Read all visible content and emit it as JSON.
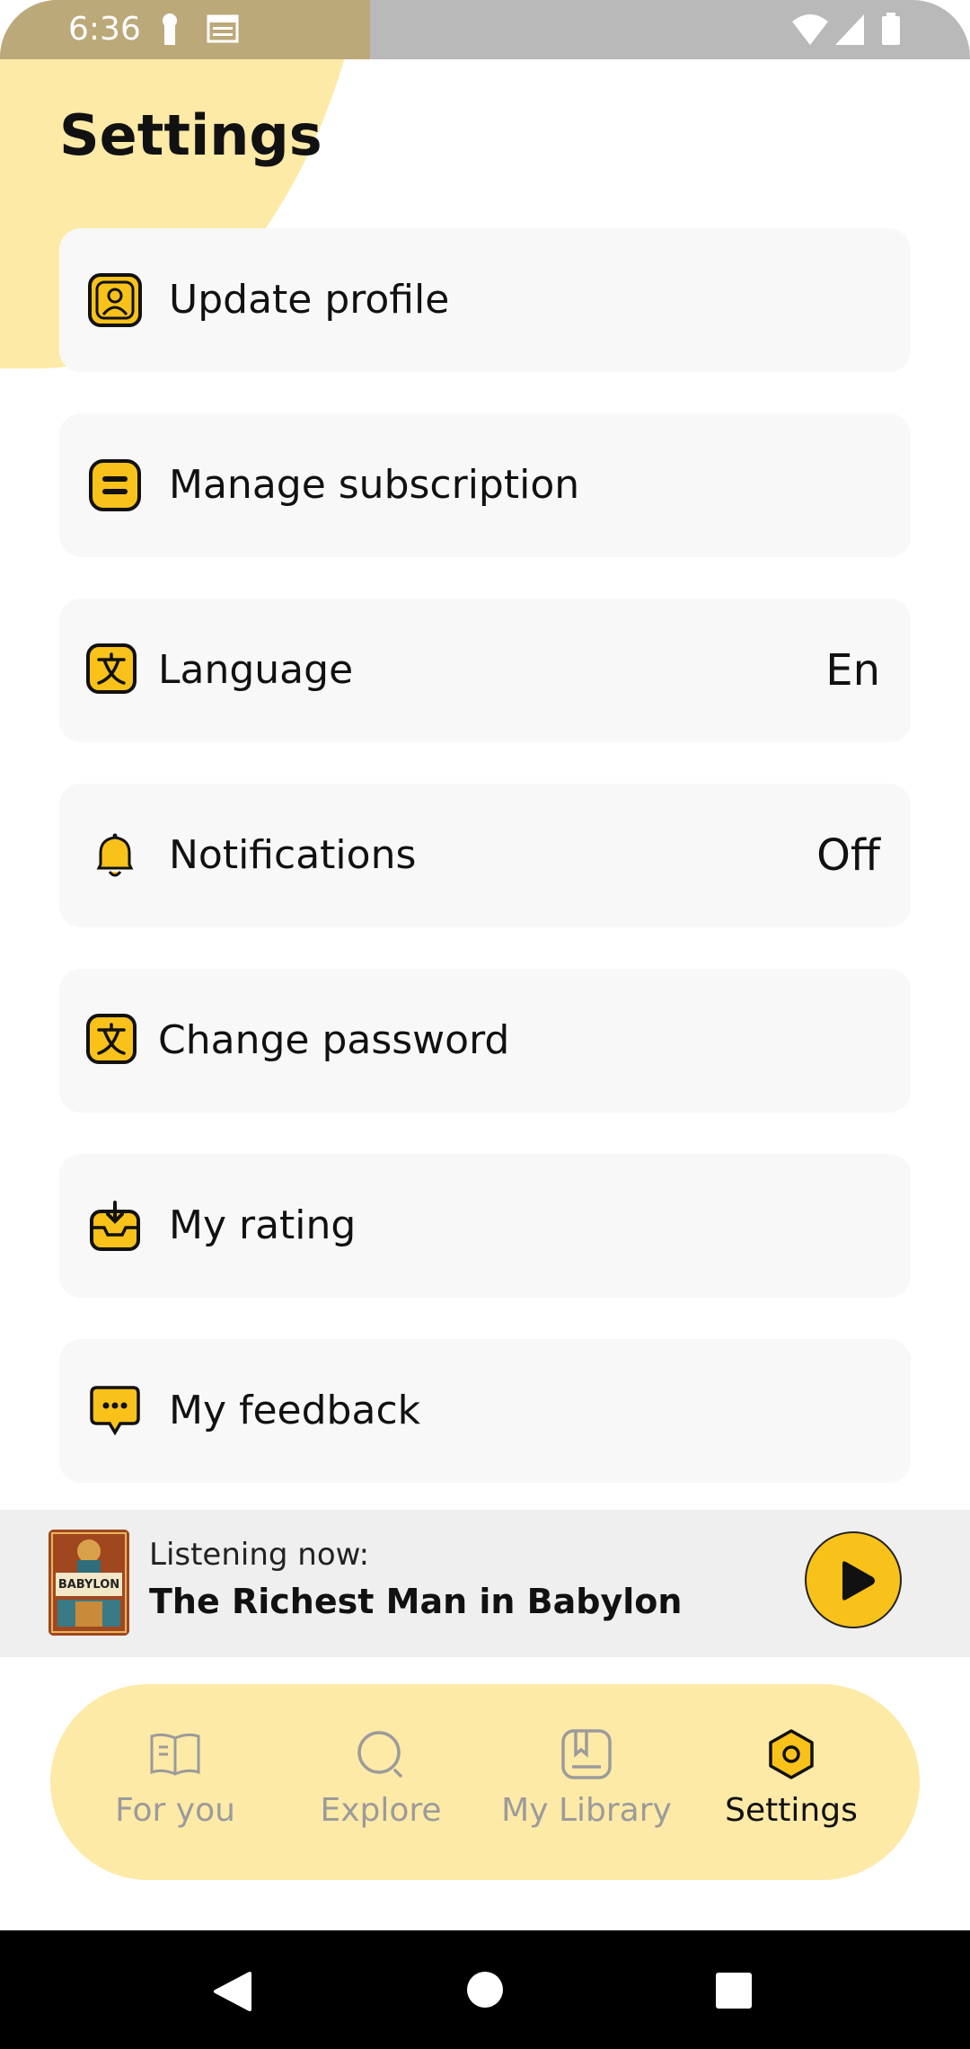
{
  "status_bar": {
    "time": "6:36",
    "icons": [
      "lock-notification-icon",
      "calendar-notification-icon",
      "wifi-icon",
      "cellular-icon",
      "battery-icon"
    ]
  },
  "page": {
    "title": "Settings"
  },
  "settings_items": [
    {
      "label": "Update profile",
      "icon": "profile-icon",
      "value": ""
    },
    {
      "label": "Manage subscription",
      "icon": "subscription-icon",
      "value": ""
    },
    {
      "label": "Language",
      "icon": "translate-icon",
      "value": "En"
    },
    {
      "label": "Notifications",
      "icon": "bell-icon",
      "value": "Off"
    },
    {
      "label": "Change password",
      "icon": "translate-icon",
      "value": ""
    },
    {
      "label": "My rating",
      "icon": "inbox-download-icon",
      "value": ""
    },
    {
      "label": "My feedback",
      "icon": "chat-bubble-icon",
      "value": ""
    }
  ],
  "now_playing": {
    "subtitle": "Listening now:",
    "title": "The Richest Man in Babylon",
    "cover_text": "BABYLON"
  },
  "bottom_nav": [
    {
      "label": "For you",
      "icon": "book-open-icon",
      "active": false
    },
    {
      "label": "Explore",
      "icon": "search-icon",
      "active": false
    },
    {
      "label": "My Library",
      "icon": "bookmark-book-icon",
      "active": false
    },
    {
      "label": "Settings",
      "icon": "settings-hexagon-icon",
      "active": true
    }
  ],
  "colors": {
    "accent": "#f8c21a",
    "accent_light": "#fdeaa7",
    "card_bg": "#f8f8f8"
  }
}
